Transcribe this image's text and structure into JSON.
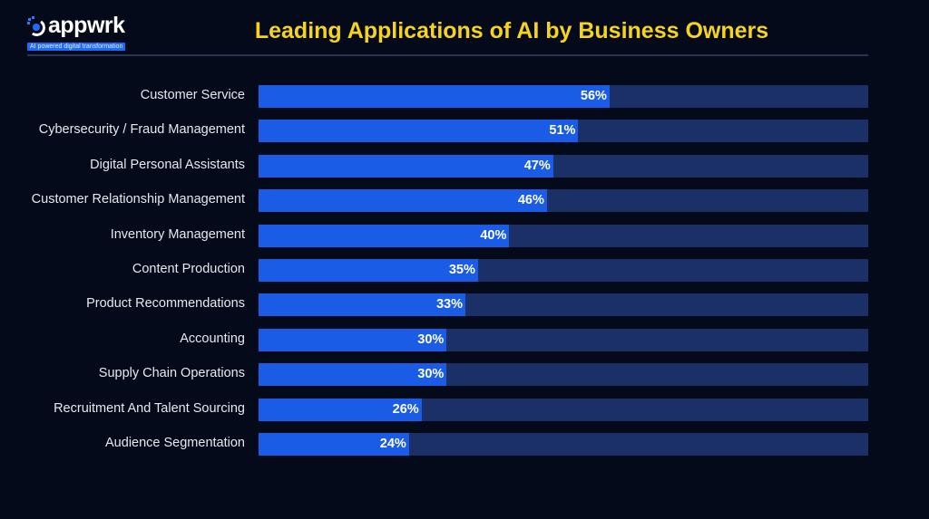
{
  "brand": {
    "name": "appwrk",
    "tagline": "AI powered digital transformation"
  },
  "colors": {
    "background": "#050a1a",
    "title": "#f6d41c",
    "bar_fill": "#1a5ce6",
    "bar_track": "#1c3068",
    "label_text": "#e6e8ee"
  },
  "chart_data": {
    "type": "bar",
    "orientation": "horizontal",
    "title": "Leading Applications of AI by Business Owners",
    "xlabel": "",
    "ylabel": "",
    "unit": "%",
    "grid": false,
    "legend": "none",
    "categories": [
      "Customer Service",
      "Cybersecurity / Fraud Management",
      "Digital Personal Assistants",
      "Customer Relationship Management",
      "Inventory Management",
      "Content Production",
      "Product Recommendations",
      "Accounting",
      "Supply Chain Operations",
      "Recruitment And Talent Sourcing",
      "Audience Segmentation"
    ],
    "values": [
      56,
      51,
      47,
      46,
      40,
      35,
      33,
      30,
      30,
      26,
      24
    ],
    "value_labels": [
      "56%",
      "51%",
      "47%",
      "46%",
      "40%",
      "35%",
      "33%",
      "30%",
      "30%",
      "26%",
      "24%"
    ],
    "xlim": [
      0,
      100
    ]
  }
}
